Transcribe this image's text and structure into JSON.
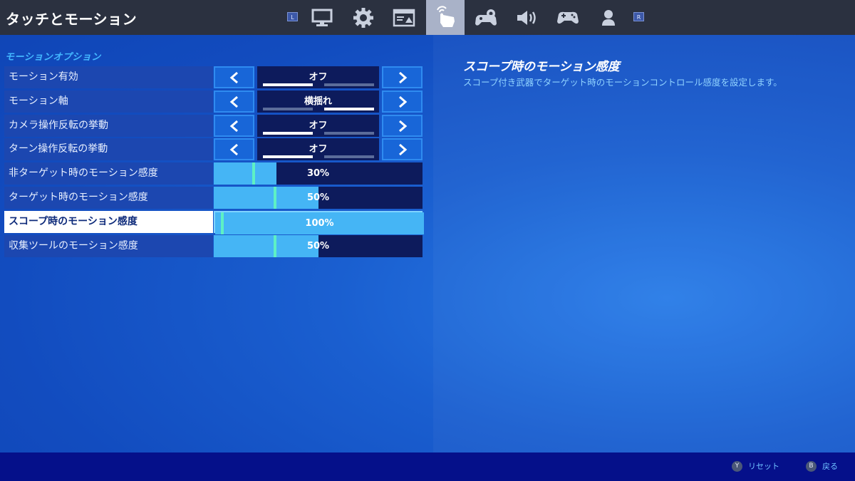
{
  "header": {
    "title": "タッチとモーション",
    "left_bumper": "L",
    "right_bumper": "R",
    "tabs": [
      {
        "icon": "monitor-icon",
        "active": false
      },
      {
        "icon": "gear-icon",
        "active": false
      },
      {
        "icon": "hud-layout-icon",
        "active": false
      },
      {
        "icon": "touch-hand-icon",
        "active": true
      },
      {
        "icon": "controller-gear-icon",
        "active": false
      },
      {
        "icon": "speaker-icon",
        "active": false
      },
      {
        "icon": "gamepad-icon",
        "active": false
      },
      {
        "icon": "person-icon",
        "active": false
      }
    ]
  },
  "section": {
    "title": "モーションオプション"
  },
  "settings": [
    {
      "label": "モーション有効",
      "value": "オフ",
      "type": "selector",
      "option_index": 0
    },
    {
      "label": "モーション軸",
      "value": "横揺れ",
      "type": "selector",
      "option_index": 1
    },
    {
      "label": "カメラ操作反転の挙動",
      "value": "オフ",
      "type": "selector",
      "option_index": 0
    },
    {
      "label": "ターン操作反転の挙動",
      "value": "オフ",
      "type": "selector",
      "option_index": 0
    },
    {
      "label": "非ターゲット時のモーション感度",
      "value": "30%",
      "type": "slider",
      "fill": 0.3
    },
    {
      "label": "ターゲット時のモーション感度",
      "value": "50%",
      "type": "slider",
      "fill": 0.5
    },
    {
      "label": "スコープ時のモーション感度",
      "value": "100%",
      "type": "slider",
      "fill": 1.0,
      "selected": true
    },
    {
      "label": "収集ツールのモーション感度",
      "value": "50%",
      "type": "slider",
      "fill": 0.5
    }
  ],
  "description": {
    "title": "スコープ時のモーション感度",
    "text": "スコープ付き武器でターゲット時のモーションコントロール感度を設定します。"
  },
  "footer": {
    "reset": {
      "button": "Y",
      "label": "リセット"
    },
    "back": {
      "button": "B",
      "label": "戻る"
    }
  },
  "colors": {
    "background": "#124cbf",
    "topbar": "#2b3140",
    "bottombar": "#05108a",
    "accent": "#43b7ff",
    "slider_fill": "#45b5f5",
    "slider_knob": "#5ef0c4"
  }
}
